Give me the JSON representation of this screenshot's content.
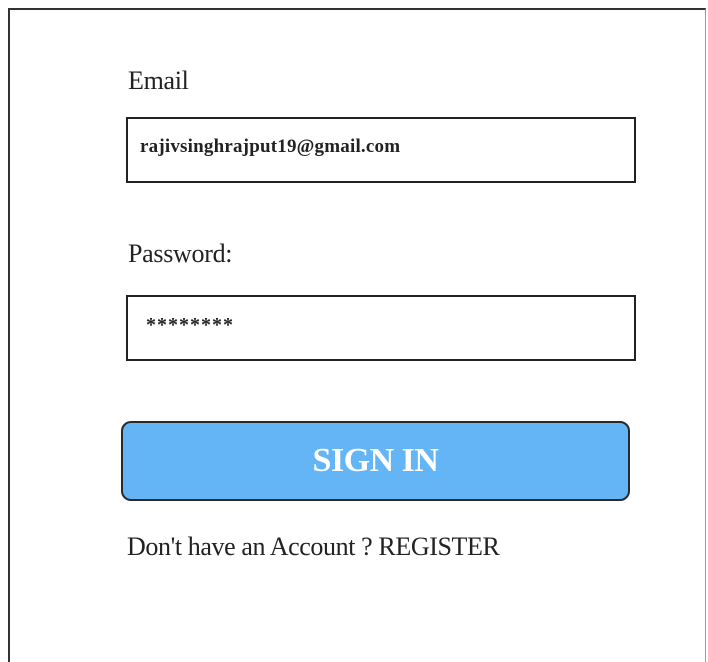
{
  "form": {
    "email_label": "Email",
    "email_value": "rajivsinghrajput19@gmail.com",
    "password_label": "Password:",
    "password_value": "********",
    "signin_label": "SIGN IN",
    "register_prompt": "Don't have an Account ? ",
    "register_link": "REGISTER"
  },
  "colors": {
    "button_background": "#64b5f6",
    "button_text": "#ffffff",
    "border": "#222222",
    "text": "#222222"
  }
}
